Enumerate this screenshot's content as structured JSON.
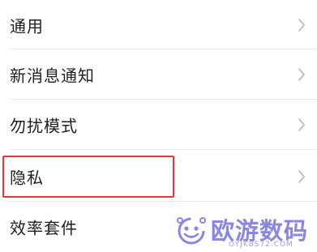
{
  "settings": {
    "items": [
      {
        "label": "通用"
      },
      {
        "label": "新消息通知"
      },
      {
        "label": "勿扰模式"
      },
      {
        "label": "隐私"
      },
      {
        "label": "效率套件"
      }
    ]
  },
  "highlight": {
    "color": "#e23a3a",
    "target": "隐私"
  },
  "watermark": {
    "text": "欧游数码",
    "url": "OYJKBS72.COM",
    "color": "#8a86e6"
  }
}
